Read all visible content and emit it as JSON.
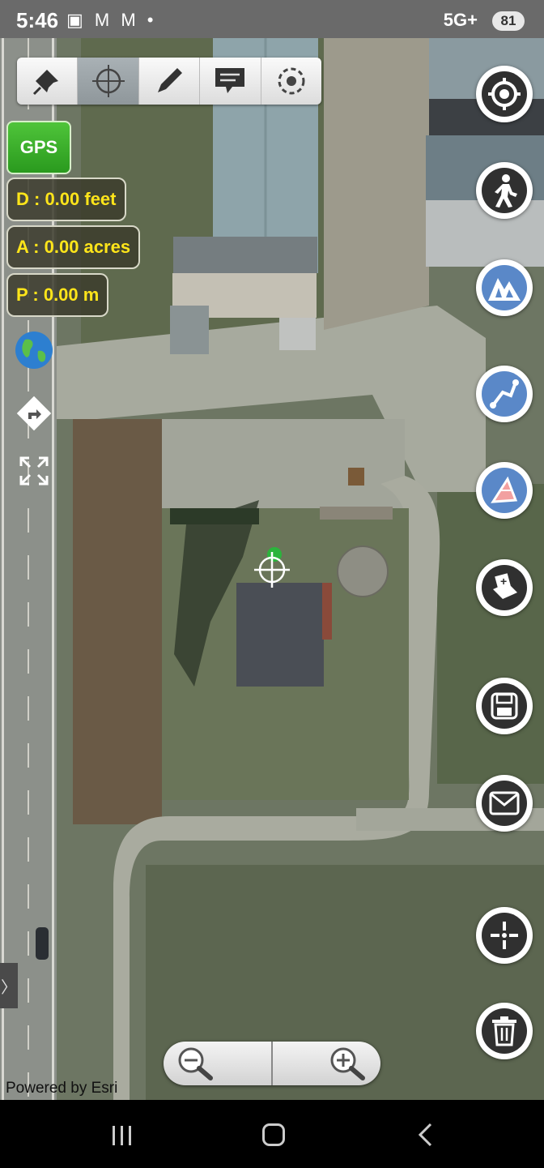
{
  "status_bar": {
    "time": "5:46",
    "left_icons": "▣ M M •",
    "network": "5G+",
    "battery": "81"
  },
  "toolbar": {
    "tools": [
      {
        "icon": "pin-icon"
      },
      {
        "icon": "crosshair-icon",
        "active": true
      },
      {
        "icon": "pencil-icon"
      },
      {
        "icon": "comment-icon"
      },
      {
        "icon": "gps-target-icon"
      }
    ]
  },
  "left_panel": {
    "gps_label": "GPS",
    "distance": "D : 0.00 feet",
    "area": "A : 0.00 acres",
    "perimeter": "P : 0.00 m",
    "icons": [
      "globe-icon",
      "direction-icon",
      "fullscreen-icon"
    ]
  },
  "right_buttons": [
    "locate-icon",
    "walk-icon",
    "mountain-icon",
    "route-icon",
    "polygon-icon",
    "map-add-icon",
    "save-icon",
    "mail-icon",
    "crosshair-add-icon",
    "trash-icon"
  ],
  "map": {
    "credit": "Powered by Esri",
    "colors": {
      "road": "#a6aaa1",
      "field": "#6f7963",
      "roof": "#8aa0a6"
    }
  },
  "zoom": {
    "out_icon": "zoom-out-icon",
    "in_icon": "zoom-in-icon"
  },
  "nav_bar": {
    "back_icon": "back-icon",
    "home_icon": "home-icon",
    "recents_icon": "recents-icon"
  }
}
